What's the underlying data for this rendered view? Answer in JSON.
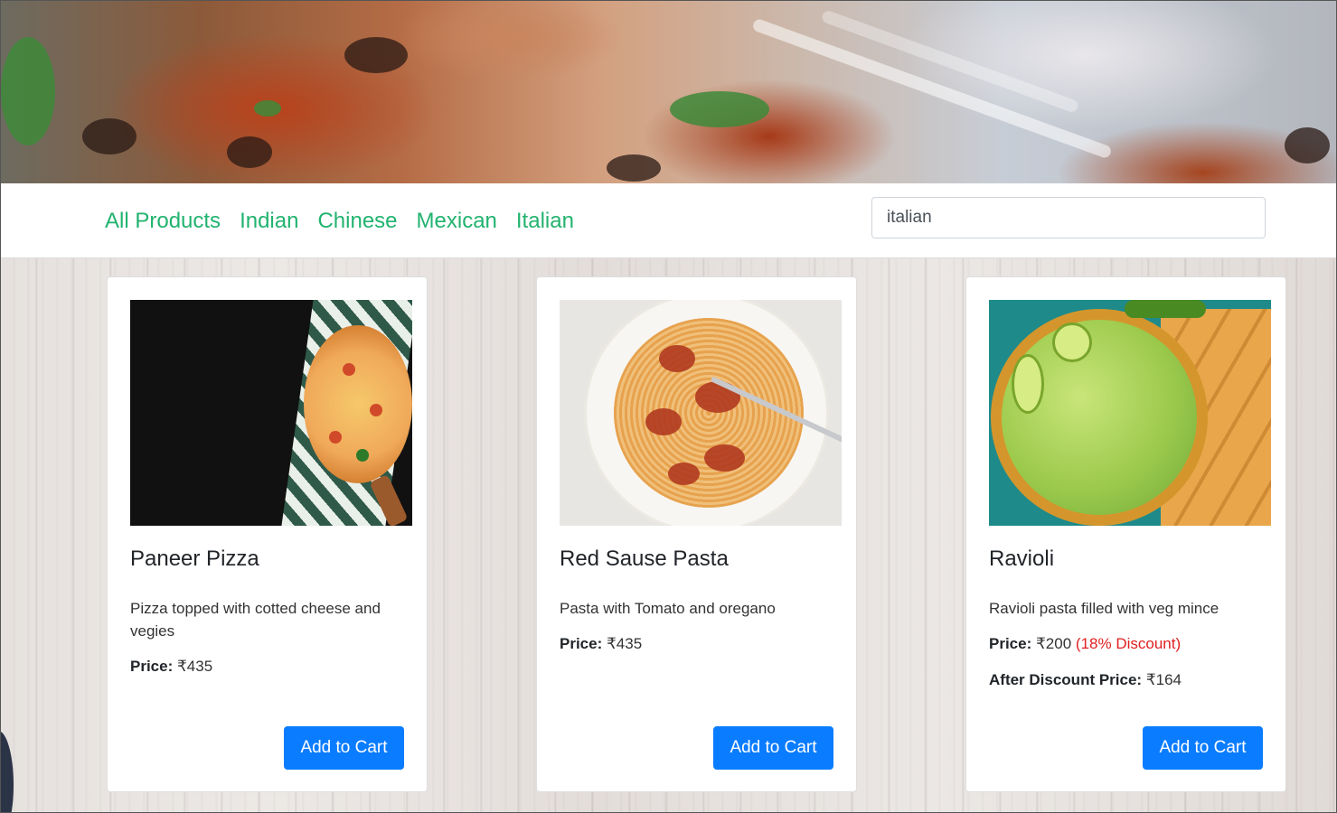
{
  "nav": {
    "links": [
      "All Products",
      "Indian",
      "Chinese",
      "Mexican",
      "Italian"
    ],
    "search_value": "italian",
    "link_color": "#22b36f"
  },
  "products": [
    {
      "name": "Paneer Pizza",
      "description": "Pizza topped with cotted cheese and vegies",
      "price_label": "Price:",
      "price": "₹435",
      "button": "Add to Cart"
    },
    {
      "name": "Red Sause Pasta",
      "description": "Pasta with Tomato and oregano",
      "price_label": "Price:",
      "price": "₹435",
      "button": "Add to Cart"
    },
    {
      "name": "Ravioli",
      "description": "Ravioli pasta filled with veg mince",
      "price_label": "Price:",
      "price": "₹200",
      "discount": "(18% Discount)",
      "after_label": "After Discount Price:",
      "after_price": "₹164",
      "button": "Add to Cart"
    }
  ],
  "colors": {
    "button": "#0a7cff",
    "discount": "#e02020"
  }
}
